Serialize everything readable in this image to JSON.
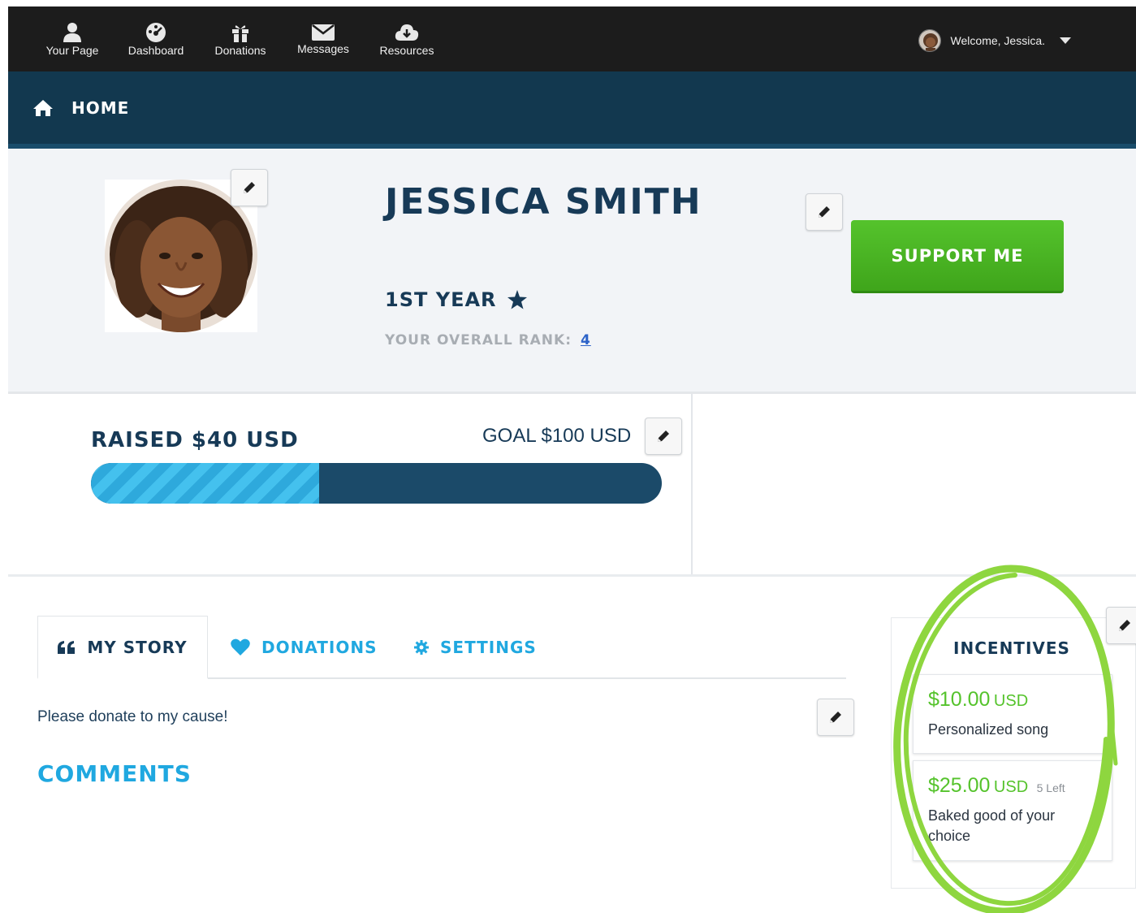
{
  "topnav": {
    "items": [
      {
        "label": "Your Page",
        "icon": "user-icon"
      },
      {
        "label": "Dashboard",
        "icon": "dashboard-icon"
      },
      {
        "label": "Donations",
        "icon": "gift-icon"
      },
      {
        "label": "Messages",
        "icon": "envelope-icon"
      },
      {
        "label": "Resources",
        "icon": "cloud-download-icon"
      }
    ],
    "welcome": "Welcome, Jessica."
  },
  "homebar": {
    "label": "HOME"
  },
  "profile": {
    "name": "JESSICA SMITH",
    "year": "1ST YEAR",
    "rank_label": "YOUR OVERALL RANK:",
    "rank_value": "4",
    "support_label": "SUPPORT ME"
  },
  "fundraising": {
    "raised_label": "RAISED $40 USD",
    "goal_label": "GOAL $100 USD",
    "progress_fraction": 0.4
  },
  "tabs": [
    {
      "label": "MY STORY",
      "icon": "quote-icon"
    },
    {
      "label": "DONATIONS",
      "icon": "heart-icon"
    },
    {
      "label": "SETTINGS",
      "icon": "gear-icon"
    }
  ],
  "story": {
    "text": "Please donate to my cause!"
  },
  "comments": {
    "title": "COMMENTS"
  },
  "incentives": {
    "title": "INCENTIVES",
    "items": [
      {
        "amount": "$10.00",
        "currency": "USD",
        "left": "",
        "description": "Personalized song"
      },
      {
        "amount": "$25.00",
        "currency": "USD",
        "left": "5 Left",
        "description": "Baked good of your choice"
      }
    ]
  },
  "colors": {
    "topbar": "#1c1c1c",
    "homebar": "#12384f",
    "accent_blue": "#20a8e0",
    "support_green": "#55c32c",
    "highlight_circle": "#8ed63f"
  }
}
